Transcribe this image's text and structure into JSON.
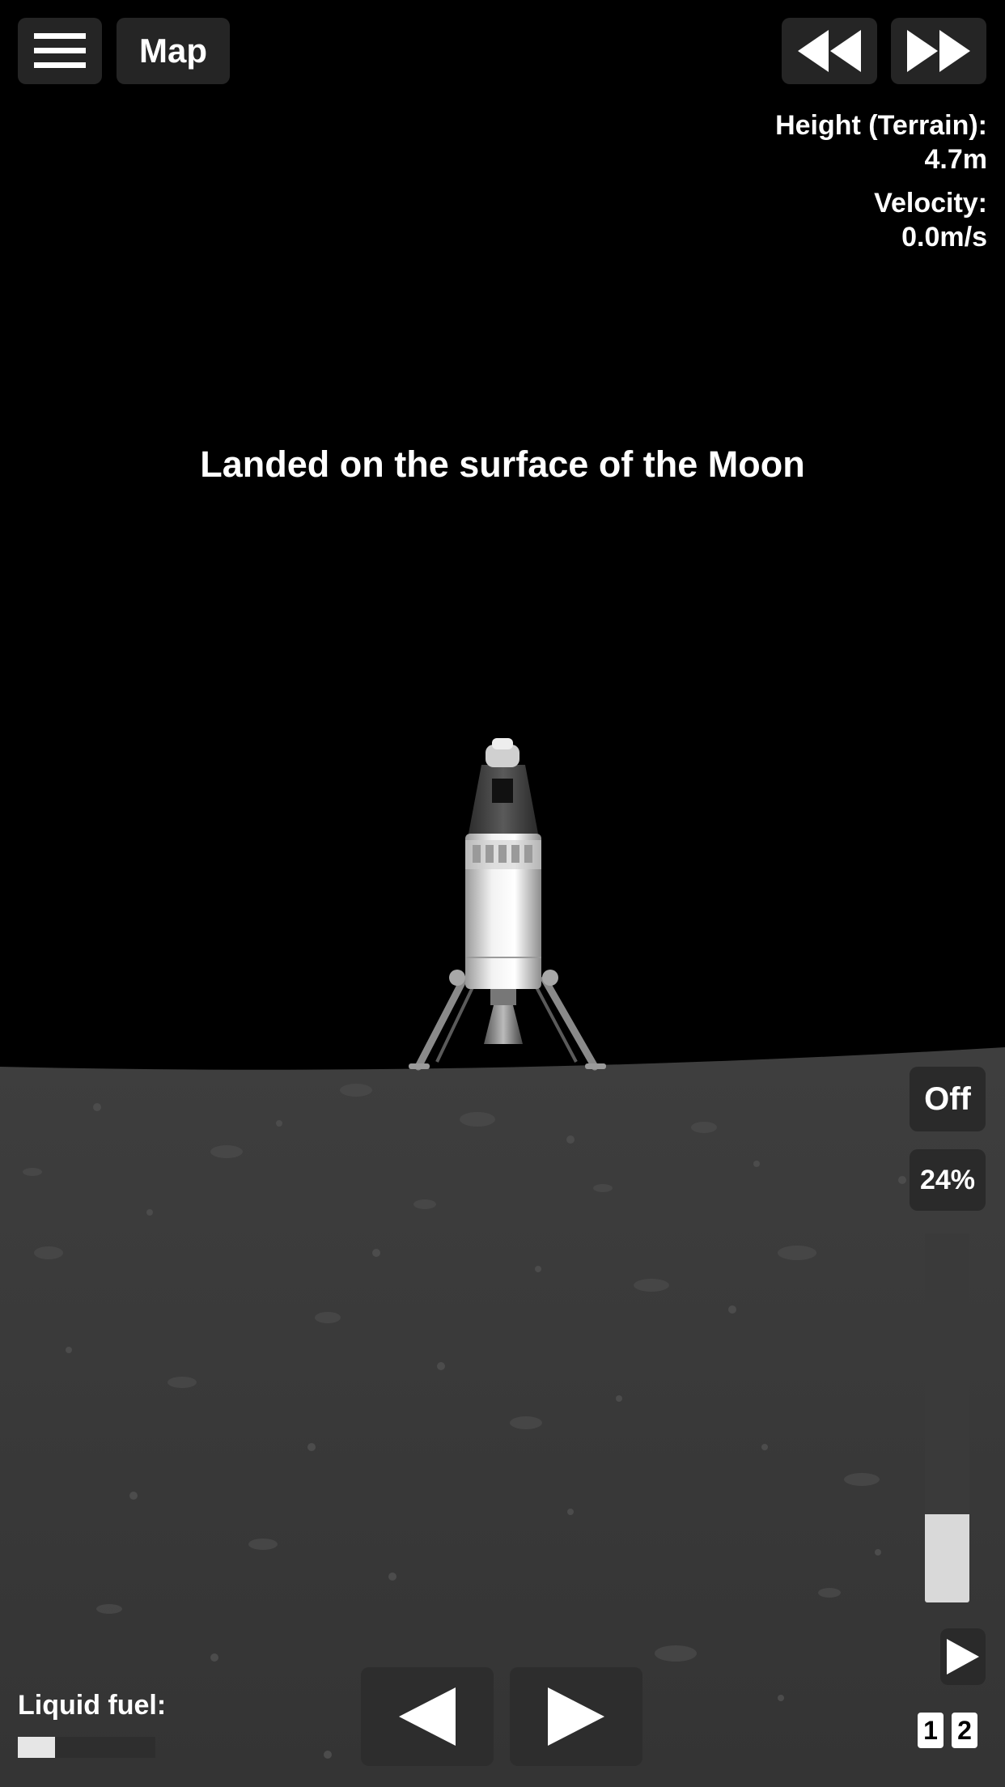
{
  "toolbar": {
    "menu_icon": "hamburger-menu-icon",
    "map_label": "Map",
    "rewind_icon": "rewind-icon",
    "fast_forward_icon": "fast-forward-icon"
  },
  "telemetry": {
    "height_label": "Height (Terrain):",
    "height_value": "4.7m",
    "velocity_label": "Velocity:",
    "velocity_value": "0.0m/s"
  },
  "status_message": "Landed on the surface of the Moon",
  "controls": {
    "sas_label": "Off",
    "throttle_label": "24%",
    "throttle_level": 0.24,
    "stage_icon": "play-stage-icon",
    "stage_numbers": [
      "1",
      "2"
    ],
    "rotate_left_icon": "rotate-left-icon",
    "rotate_right_icon": "rotate-right-icon"
  },
  "fuel": {
    "label": "Liquid fuel:",
    "level": 0.27
  },
  "colors": {
    "sky": "#000000",
    "ground": "#3b3b3b",
    "button_bg": "#252525",
    "text": "#ffffff"
  }
}
